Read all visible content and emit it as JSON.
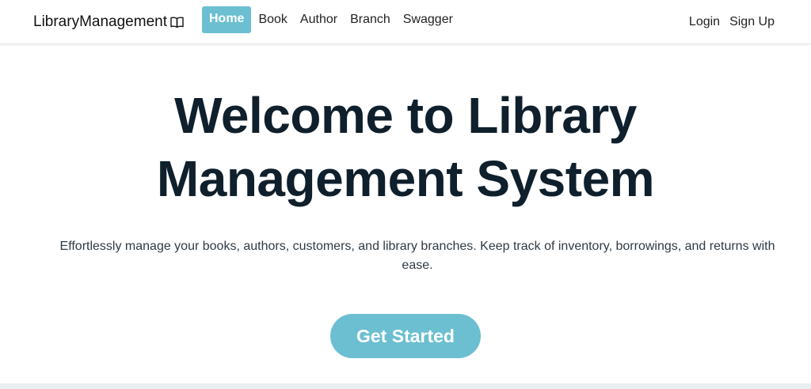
{
  "navbar": {
    "brand": "LibraryManagement",
    "brand_icon": "book-icon",
    "links": [
      {
        "label": "Home",
        "active": true
      },
      {
        "label": "Book",
        "active": false
      },
      {
        "label": "Author",
        "active": false
      },
      {
        "label": "Branch",
        "active": false
      },
      {
        "label": "Swagger",
        "active": false
      }
    ],
    "auth": {
      "login": "Login",
      "signup": "Sign Up"
    }
  },
  "hero": {
    "title_line1": "Welcome to Library",
    "title_line2": "Management System",
    "description": "Effortlessly manage your books, authors, customers, and library branches. Keep track of inventory, borrowings, and returns with ease.",
    "cta_label": "Get Started"
  },
  "colors": {
    "accent": "#6bbfd0",
    "heading": "#0f1f2c"
  }
}
